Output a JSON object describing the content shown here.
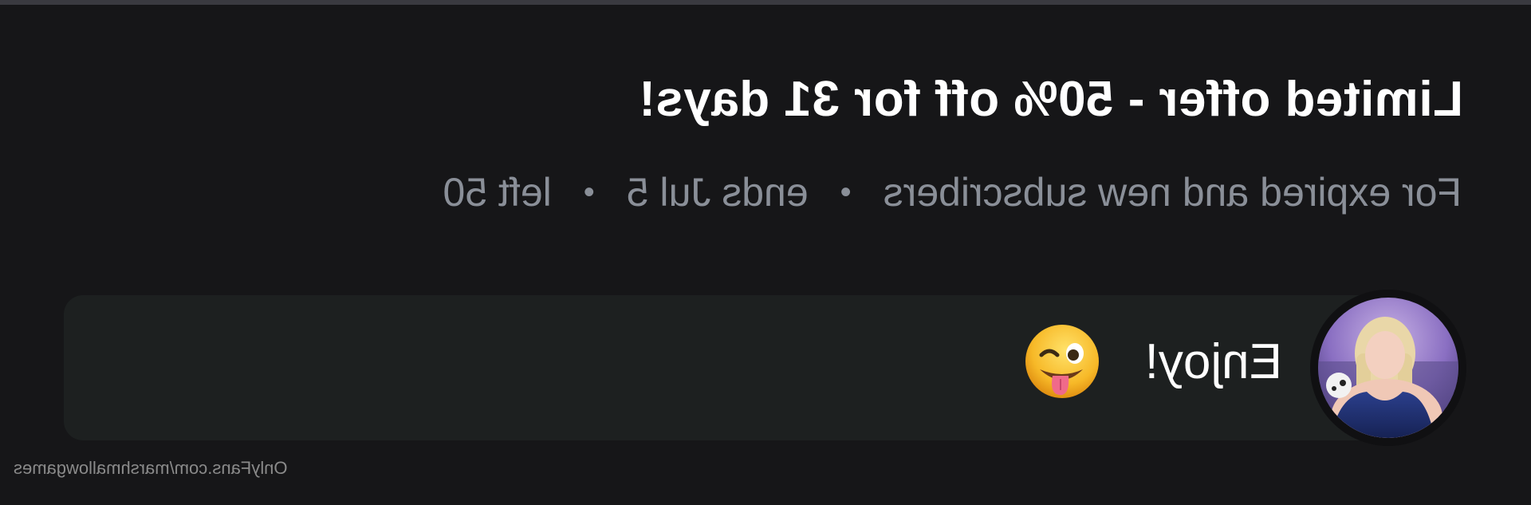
{
  "offer": {
    "title": "Limited offer - 50% off for 31 days!",
    "audience": "For expired and new subscribers",
    "ends": "ends Jul 5",
    "left": "left 50",
    "separator": "•"
  },
  "message": {
    "text": "Enjoy!",
    "emoji": "winking-face-with-tongue-icon"
  },
  "watermark": "OnlyFans.com/marshmallowgames",
  "colors": {
    "background": "#161618",
    "message_box": "#1d2020",
    "title": "#ffffff",
    "subtitle": "#8a8f98"
  }
}
